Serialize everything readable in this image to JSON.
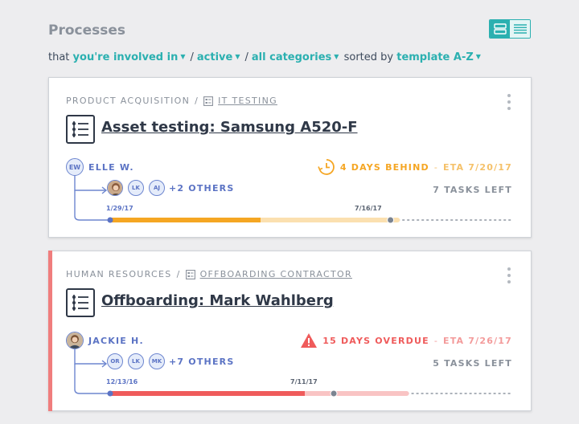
{
  "header": {
    "title": "Processes",
    "view_toggle": [
      "list-view-icon",
      "compact-view-icon"
    ]
  },
  "filters": {
    "prefix": "that",
    "involvement": "you're involved in",
    "status": "active",
    "categories": "all categories",
    "sorted_label": "sorted by",
    "sort": "template A-Z"
  },
  "processes": [
    {
      "category": "PRODUCT ACQUISITION",
      "template": "IT TESTING",
      "title": "Asset testing: Samsung A520-F",
      "owner": {
        "initials": "EW",
        "name": "ELLE W."
      },
      "members": [
        "LK",
        "AJ"
      ],
      "others": "+2 OTHERS",
      "status_text": "4 DAYS BEHIND",
      "eta": "ETA 7/20/17",
      "tasks_left": "7 TASKS LEFT",
      "start_date": "1/29/17",
      "current_date": "7/16/17",
      "status_color": "#f5a623",
      "progress_fraction": 0.68,
      "today_fraction": 0.84,
      "remaining_fraction": 0.94
    },
    {
      "category": "HUMAN RESOURCES",
      "template": "OFFBOARDING CONTRACTOR",
      "title": "Offboarding: Mark Wahlberg",
      "owner": {
        "name": "JACKIE H."
      },
      "members": [
        "OR",
        "LK",
        "MK"
      ],
      "others": "+7 OTHERS",
      "status_text": "15 DAYS OVERDUE",
      "eta": "ETA 7/26/17",
      "tasks_left": "5 TASKS LEFT",
      "start_date": "12/13/16",
      "current_date": "7/11/17",
      "status_color": "#ef5b5b",
      "progress_fraction": 0.88,
      "today_fraction": 0.67,
      "remaining_fraction": 0.97
    }
  ],
  "colors": {
    "accent": "#2bb0b0",
    "user": "#5b73c4",
    "behind": "#f5a623",
    "behind_light": "#fbe0b0",
    "overdue": "#ef5b5b",
    "overdue_light": "#f9c4c4"
  }
}
